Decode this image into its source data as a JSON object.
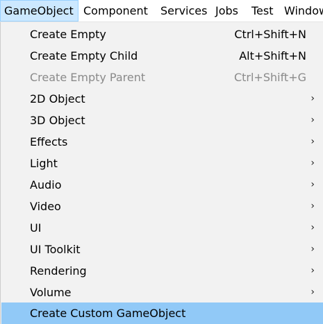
{
  "menubar": {
    "items": [
      {
        "label": "GameObject"
      },
      {
        "label": "Component"
      },
      {
        "label": "Services"
      },
      {
        "label": "Jobs"
      },
      {
        "label": "Test"
      },
      {
        "label": "Window"
      }
    ]
  },
  "menu": {
    "items": [
      {
        "label": "Create Empty",
        "shortcut": "Ctrl+Shift+N"
      },
      {
        "label": "Create Empty Child",
        "shortcut": "Alt+Shift+N"
      },
      {
        "label": "Create Empty Parent",
        "shortcut": "Ctrl+Shift+G",
        "disabled": true
      },
      {
        "label": "2D Object",
        "submenu_arrow": "›"
      },
      {
        "label": "3D Object",
        "submenu_arrow": "›"
      },
      {
        "label": "Effects",
        "submenu_arrow": "›"
      },
      {
        "label": "Light",
        "submenu_arrow": "›"
      },
      {
        "label": "Audio",
        "submenu_arrow": "›"
      },
      {
        "label": "Video",
        "submenu_arrow": "›"
      },
      {
        "label": "UI",
        "submenu_arrow": "›"
      },
      {
        "label": "UI Toolkit",
        "submenu_arrow": "›"
      },
      {
        "label": "Rendering",
        "submenu_arrow": "›"
      },
      {
        "label": "Volume",
        "submenu_arrow": "›"
      },
      {
        "label": "Create Custom GameObject",
        "highlighted": true
      }
    ]
  },
  "colors": {
    "menubar_active_bg": "#cce8ff",
    "highlight_bg": "#91c9f7",
    "disabled_text": "#8a8a8a",
    "menu_bg": "#f2f2f2"
  }
}
